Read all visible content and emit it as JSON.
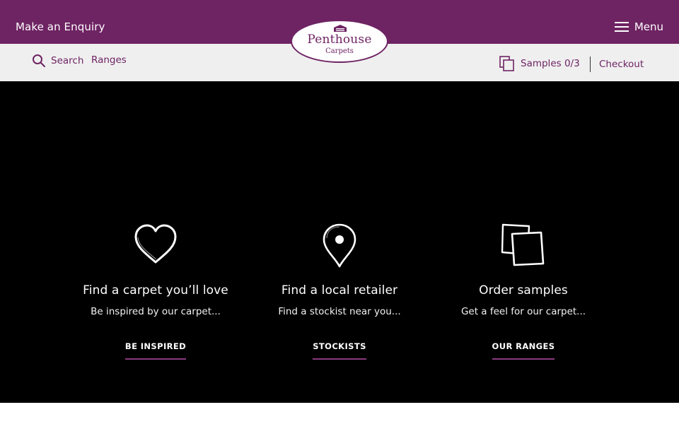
{
  "header": {
    "enquiry_label": "Make an Enquiry",
    "menu_label": "Menu",
    "logo": {
      "name": "Penthouse",
      "sub": "Carpets"
    },
    "search_label": "Search",
    "ranges_label": "Ranges",
    "samples_label": "Samples 0/3",
    "checkout_label": "Checkout"
  },
  "features": [
    {
      "icon": "heart-icon",
      "title": "Find a carpet you’ll love",
      "text": "Be inspired by our carpet...",
      "link": "BE INSPIRED"
    },
    {
      "icon": "map-pin-icon",
      "title": "Find a local retailer",
      "text": "Find a stockist near you...",
      "link": "STOCKISTS"
    },
    {
      "icon": "samples-icon",
      "title": "Order samples",
      "text": "Get a feel for our carpet...",
      "link": "OUR RANGES"
    }
  ],
  "colors": {
    "brand_purple": "#6e2363",
    "subbar_bg": "#efefef",
    "hero_bg": "#000000",
    "link_underline": "#8a3a7e"
  }
}
